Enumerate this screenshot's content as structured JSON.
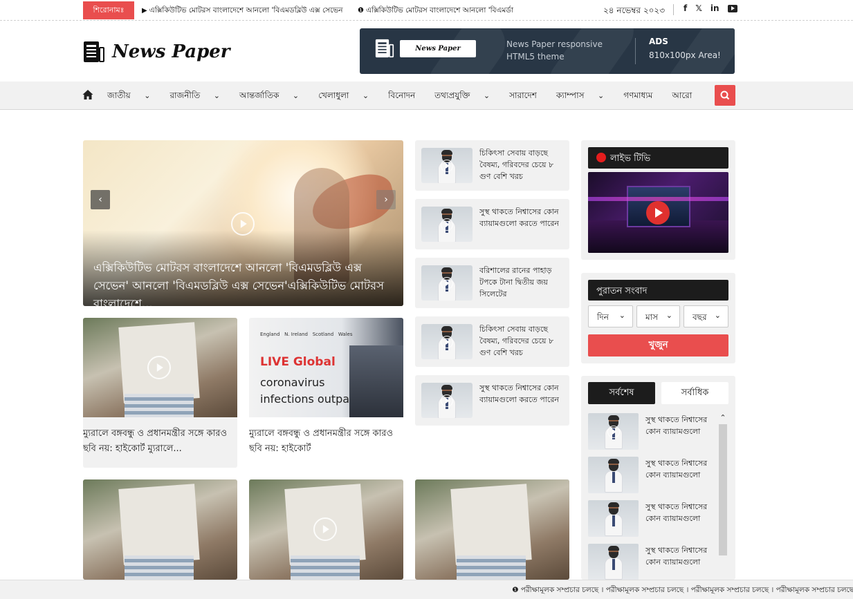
{
  "ticker": {
    "label": "শিরোনামঃ",
    "items": [
      "এক্সিকিউটিভ মোটরস বাংলাদেশে আনলো 'বিএমডব্লিউ এক্স সেভেন",
      "এক্সিকিউটিভ মোটরস বাংলাদেশে আনলো 'বিএমর্ডা"
    ],
    "date": "২৪ নভেম্বর ২০২৩",
    "social": [
      "f",
      "𝕏",
      "in",
      "▶"
    ]
  },
  "header": {
    "logo_text": "News Paper",
    "ad": {
      "box_text": "News Paper",
      "description": "News Paper responsive HTML5 theme",
      "title": "ADS",
      "subtitle": "810x100px Area!"
    }
  },
  "nav": {
    "items": [
      "জাতীয়",
      "রাজনীতি",
      "আন্তর্জাতিক",
      "খেলাধুলা",
      "বিনোদন",
      "তথ্যপ্রযুক্তি",
      "সারাদেশ",
      "ক্যাম্পাস",
      "গণমাধ্যম",
      "আরো"
    ],
    "has_dropdown": [
      true,
      true,
      true,
      true,
      false,
      true,
      false,
      true,
      false,
      false
    ]
  },
  "hero": {
    "title": "এক্সিকিউটিভ মোটরস বাংলাদেশে আনলো 'বিএমডব্লিউ এক্স সেভেন' আনলো 'বিএমডব্লিউ এক্স সেভেন'এক্সিকিউটিভ মোটরস বাংলাদেশে...",
    "prev": "‹",
    "next": "›"
  },
  "cards": [
    {
      "title": "ম্যুরালে বঙ্গবন্ধু ও প্রধানমন্ত্রীর সঙ্গে কারও ছবি নয়: হাইকোর্ট ম্যুরালে..."
    },
    {
      "title": "ম্যুরালে বঙ্গবন্ধু ও প্রধানমন্ত্রীর সঙ্গে কারও ছবি নয়: হাইকোর্ট",
      "image_text": [
        "England",
        "N. Ireland",
        "Scotland",
        "Wales",
        "LIVE Global",
        "coronavirus",
        "infections outpace"
      ]
    }
  ],
  "side_list": [
    "চিকিৎসা সেবায় বাড়ছে বৈষম্য, গরিবদের চেয়ে ৮ গুণ বেশি খরচ",
    "সুস্থ থাকতে নিশ্বাসের কোন ব্যায়ামগুলো করতে পারেন",
    "বরিশালের রানের পাহাড় টপকে টানা দ্বিতীয় জয় সিলেটের",
    "চিকিৎসা সেবায় বাড়ছে বৈষম্য, গরিবদের চেয়ে ৮ গুণ বেশি খরচ",
    "সুস্থ থাকতে নিশ্বাসের কোন ব্যায়ামগুলো করতে পারেন"
  ],
  "sidebar": {
    "live_tv": "লাইভ টিভি",
    "archive": {
      "title": "পুরাতন সংবাদ",
      "day": "দিন",
      "month": "মাস",
      "year": "বছর",
      "search": "খুজুন"
    },
    "tabs": {
      "latest": "সর্বশেষ",
      "popular": "সর্বাধিক"
    },
    "latest_items": [
      "সুস্থ থাকতে নিশ্বাসের কোন ব্যায়ামগুলো",
      "সুস্থ থাকতে নিশ্বাসের কোন ব্যায়ামগুলো",
      "সুস্থ থাকতে নিশ্বাসের কোন ব্যায়ামগুলো",
      "সুস্থ থাকতে নিশ্বাসের কোন ব্যায়ামগুলো"
    ]
  },
  "bottom_ticker": "পরীক্ষামূলক সম্প্রচার চলছে । পরীক্ষামূলক সম্প্রচার চলছে । পরীক্ষামূলক সম্প্রচার চলছে । পরীক্ষামূলক সম্প্রচার চলছে ।",
  "colors": {
    "accent": "#e94e4e",
    "dark": "#1c1c1c",
    "ad_bg": "#283645",
    "panel": "#f1f1f1"
  }
}
